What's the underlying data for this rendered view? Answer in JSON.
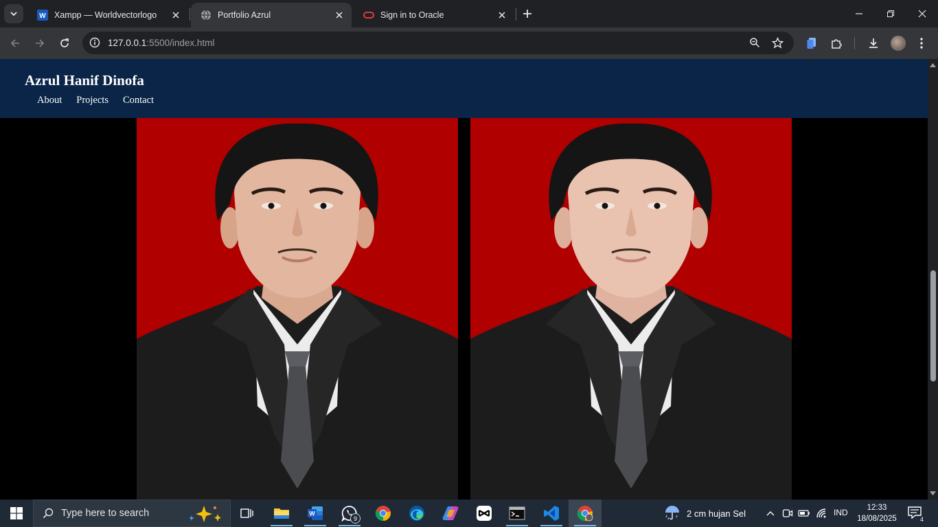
{
  "browser": {
    "tabs": [
      {
        "title": "Xampp — Worldvectorlogo",
        "favicon": "word-icon",
        "active": false
      },
      {
        "title": "Portfolio Azrul",
        "favicon": "globe-icon",
        "active": true
      },
      {
        "title": "Sign in to Oracle",
        "favicon": "oracle-icon",
        "active": false
      }
    ],
    "address": {
      "host": "127.0.0.1",
      "rest": ":5500/index.html"
    }
  },
  "site": {
    "title": "Azrul Hanif Dinofa",
    "nav": [
      "About",
      "Projects",
      "Contact"
    ],
    "colors": {
      "header": "#0a2547",
      "photo_bg": "#b20000",
      "page_bg": "#000000"
    }
  },
  "taskbar": {
    "search_placeholder": "Type here to search",
    "whatsapp_badge": "9",
    "weather": "2 cm hujan Sel",
    "language": "IND",
    "time": "12:33",
    "date": "18/08/2025",
    "notifications": "4"
  }
}
